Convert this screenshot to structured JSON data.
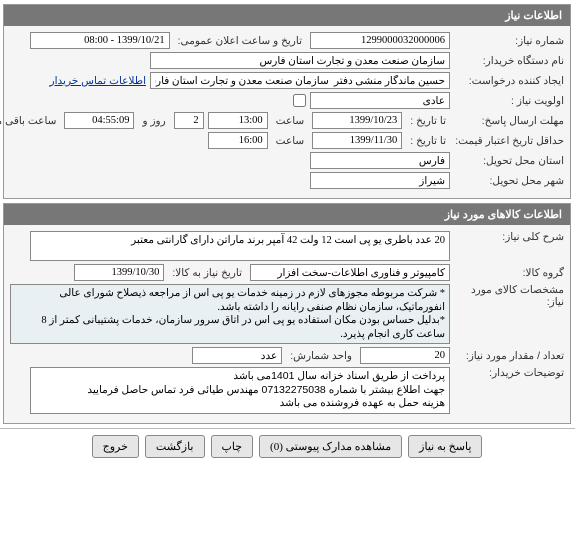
{
  "panel1": {
    "title": "اطلاعات نیاز",
    "need_no_label": "شماره نیاز:",
    "need_no": "1299000032000006",
    "announce_label": "تاریخ و ساعت اعلان عمومی:",
    "announce_value": "1399/10/21 - 08:00",
    "buyer_label": "نام دستگاه خریدار:",
    "buyer_value": "سازمان صنعت معدن و تجارت استان فارس",
    "requester_label": "ایجاد کننده درخواست:",
    "requester_value": "حسین ماندگار منشی دفتر  سازمان صنعت معدن و تجارت استان فارس",
    "contact_link": "اطلاعات تماس خریدار",
    "priority_label": "اولویت نیاز :",
    "priority_value": "عادی",
    "deadline_label": "مهلت ارسال پاسخ:",
    "deadline_until": "تا تاریخ :",
    "deadline_date": "1399/10/23",
    "deadline_time_label": "ساعت",
    "deadline_time": "13:00",
    "remaining_days": "2",
    "remaining_days_label": "روز و",
    "remaining_time": "04:55:09",
    "remaining_time_label": "ساعت باقی مانده",
    "credit_label": "حداقل تاریخ اعتبار قیمت:",
    "credit_until": "تا تاریخ :",
    "credit_date": "1399/11/30",
    "credit_time_label": "ساعت",
    "credit_time": "16:00",
    "province_label": "استان محل تحویل:",
    "province_value": "فارس",
    "city_label": "شهر محل تحویل:",
    "city_value": "شیراز"
  },
  "panel2": {
    "title": "اطلاعات کالاهای مورد نیاز",
    "desc_label": "شرح کلی نیاز:",
    "desc_value": "20 عدد باطری یو پی است 12 ولت 42 آمپر برند ماراتن دارای گارانتی معتبر",
    "group_label": "گروه کالا:",
    "group_value": "کامپیوتر و فناوری اطلاعات-سخت افزار",
    "group_date_label": "تاریخ نیاز به کالا:",
    "group_date": "1399/10/30",
    "spec_label": "مشخصات کالای مورد نیاز:",
    "spec_value": "* شرکت مربوطه مجوزهای لازم در زمینه خدمات یو پی اس از مراجعه ذیصلاح شورای عالی انفورماتیک، سازمان نظام صنفی رایانه را داشته باشد.\n*بدلیل حساس بودن مکان استفاده یو پی اس در اتاق سرور سازمان، خدمات پشتیبانی کمتر از 8 ساعت کاری انجام پذیرد.",
    "qty_label": "تعداد / مقدار مورد نیاز:",
    "qty_value": "20",
    "unit_label": "واحد شمارش:",
    "unit_value": "عدد",
    "notes_label": "توضیحات خریدار:",
    "notes_value": "پرداخت از طریق اسناد خزانه سال 1401می باشد\nجهت اطلاع بیشتر با شماره 07132275038 مهندس طیائی فرد تماس حاصل فرمایید\nهزینه حمل به عهده فروشنده می باشد"
  },
  "buttons": {
    "respond": "پاسخ به نیاز",
    "attachments": "مشاهده مدارک پیوستی (0)",
    "print": "چاپ",
    "back": "بازگشت",
    "exit": "خروج"
  }
}
